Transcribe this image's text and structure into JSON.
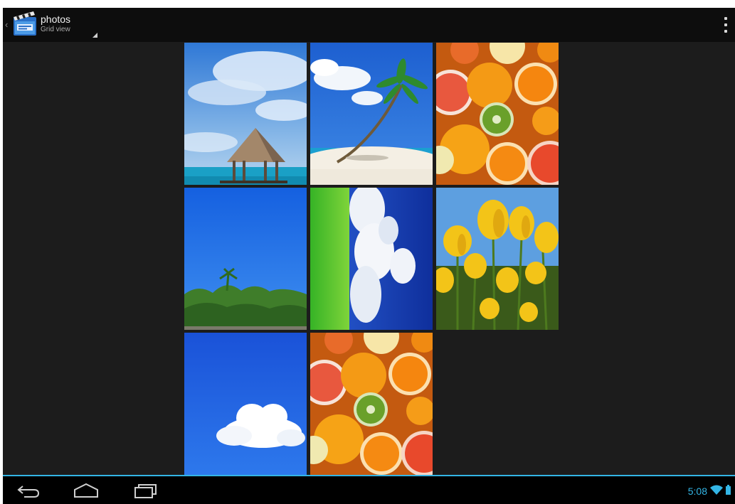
{
  "action_bar": {
    "title": "photos",
    "subtitle": "Grid view",
    "app_icon": "clapperboard-icon",
    "overflow_icon": "overflow-menu-icon"
  },
  "grid": {
    "photos": [
      {
        "subject": "beach hut"
      },
      {
        "subject": "palm tree island"
      },
      {
        "subject": "citrus fruits"
      },
      {
        "subject": "tropical trees and sky"
      },
      {
        "subject": "grass and clouds"
      },
      {
        "subject": "yellow tulips"
      },
      {
        "subject": "single cloud"
      },
      {
        "subject": "citrus fruits"
      }
    ]
  },
  "navigation": {
    "back_icon": "back-icon",
    "home_icon": "home-icon",
    "recent_icon": "recent-apps-icon"
  },
  "status": {
    "time": "5:08",
    "wifi_icon": "wifi-icon",
    "battery_icon": "battery-icon"
  },
  "colors": {
    "accent": "#33b5e5",
    "background": "#1c1c1c",
    "action_bar": "#0d0d0d"
  }
}
